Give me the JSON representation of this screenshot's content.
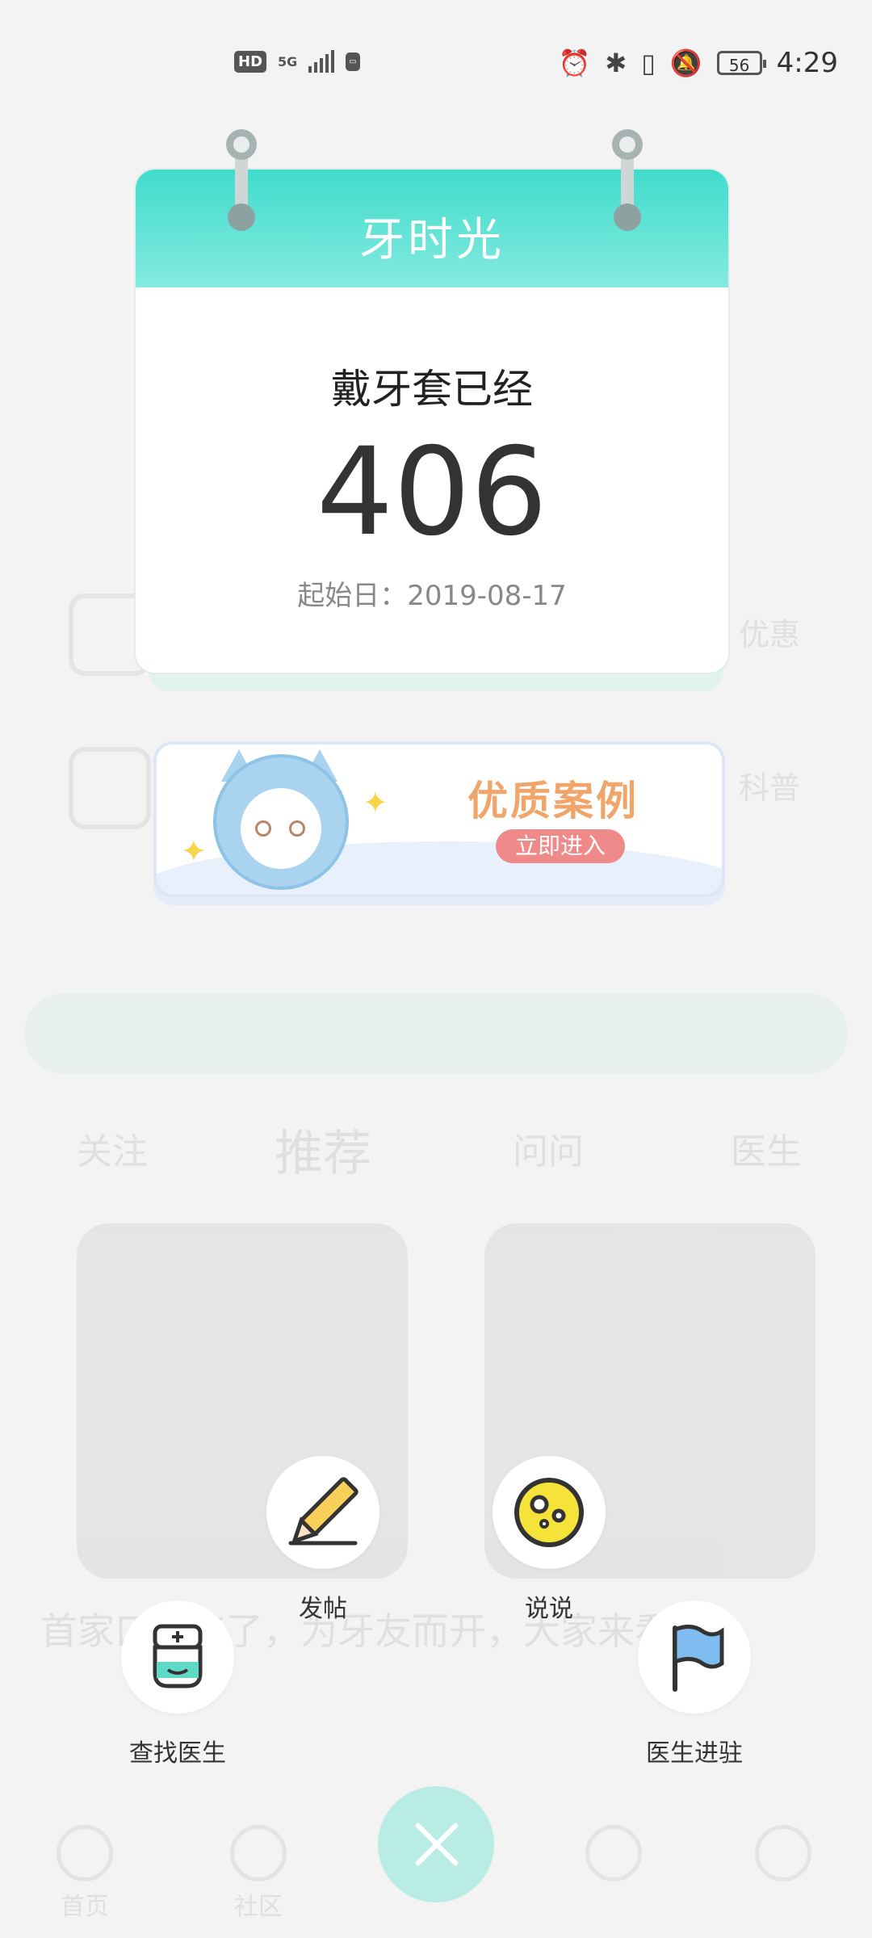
{
  "status_bar": {
    "hd": "HD",
    "net": "5G",
    "time": "4:29",
    "battery": "56",
    "icons": [
      "alarm-icon",
      "bluetooth-icon",
      "vibrate-icon",
      "mute-icon"
    ]
  },
  "calendar": {
    "title": "牙时光",
    "label": "戴牙套已经",
    "days": "406",
    "start_date": "起始日：2019-08-17"
  },
  "banner": {
    "title": "优质案例",
    "button": "立即进入"
  },
  "actions": {
    "post": "发帖",
    "talk": "说说",
    "find_doctor": "查找医生",
    "doctor_join": "医生进驻"
  },
  "background": {
    "tabs": [
      "关注",
      "推荐",
      "问问",
      "医生"
    ],
    "side_labels": [
      "优惠",
      "科普"
    ],
    "headline": "首家口腔来了，为牙友而开，大家来看",
    "nav": [
      "首页",
      "社区",
      "",
      "",
      ""
    ]
  },
  "colors": {
    "accent": "#40dccc",
    "banner_title": "#f0a56a",
    "banner_button": "#f08a8a",
    "close_button": "#b9ece4"
  }
}
